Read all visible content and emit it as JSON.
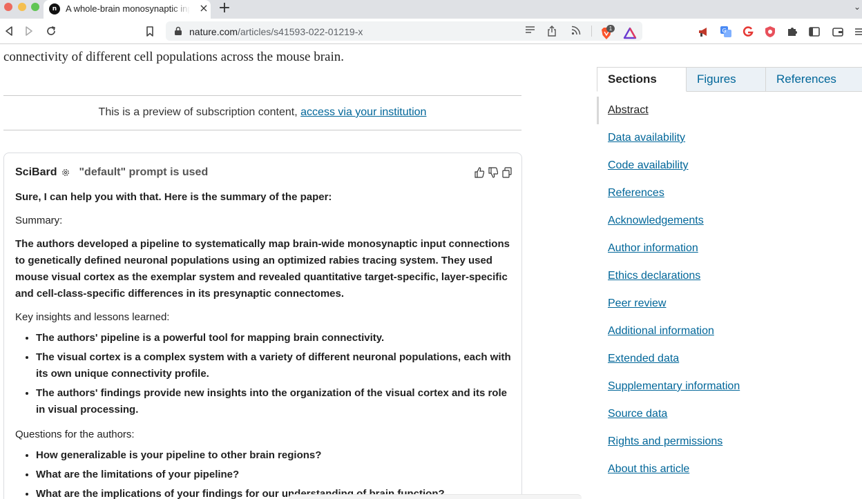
{
  "browser": {
    "tab": {
      "favicon": "n",
      "title": "A whole-brain monosynaptic input connectome to neuron classes in mouse visual cortex",
      "close": "×"
    },
    "new_tab": "+",
    "tab_menu": "⌄",
    "url": {
      "host": "nature.com",
      "path": "/articles/s41593-022-01219-x"
    },
    "brave_count": "1",
    "colors": {
      "brave": "#fb542b",
      "accent": "#006699"
    }
  },
  "article": {
    "lead": "connectivity of different cell populations across the mouse brain.",
    "preview": {
      "text": "This is a preview of subscription content,",
      "link": "access via your institution"
    }
  },
  "scibard": {
    "name": "SciBard",
    "prompt_note": "\"default\" prompt is used",
    "intro": "Sure, I can help you with that. Here is the summary of the paper:",
    "summary_label": "Summary:",
    "summary": "The authors developed a pipeline to systematically map brain-wide monosynaptic input connections to genetically defined neuronal populations using an optimized rabies tracing system. They used mouse visual cortex as the exemplar system and revealed quantitative target-specific, layer-specific and cell-class-specific differences in its presynaptic connectomes.",
    "insights_label": "Key insights and lessons learned:",
    "insights": [
      "The authors' pipeline is a powerful tool for mapping brain connectivity.",
      "The visual cortex is a complex system with a variety of different neuronal populations, each with its own unique connectivity profile.",
      "The authors' findings provide new insights into the organization of the visual cortex and its role in visual processing."
    ],
    "questions_label": "Questions for the authors:",
    "questions": [
      "How generalizable is your pipeline to other brain regions?",
      "What are the limitations of your pipeline?",
      "What are the implications of your findings for our understanding of brain function?"
    ]
  },
  "sidebar": {
    "tabs": [
      "Sections",
      "Figures",
      "References"
    ],
    "items": [
      "Abstract",
      "Data availability",
      "Code availability",
      "References",
      "Acknowledgements",
      "Author information",
      "Ethics declarations",
      "Peer review",
      "Additional information",
      "Extended data",
      "Supplementary information",
      "Source data",
      "Rights and permissions",
      "About this article"
    ]
  }
}
